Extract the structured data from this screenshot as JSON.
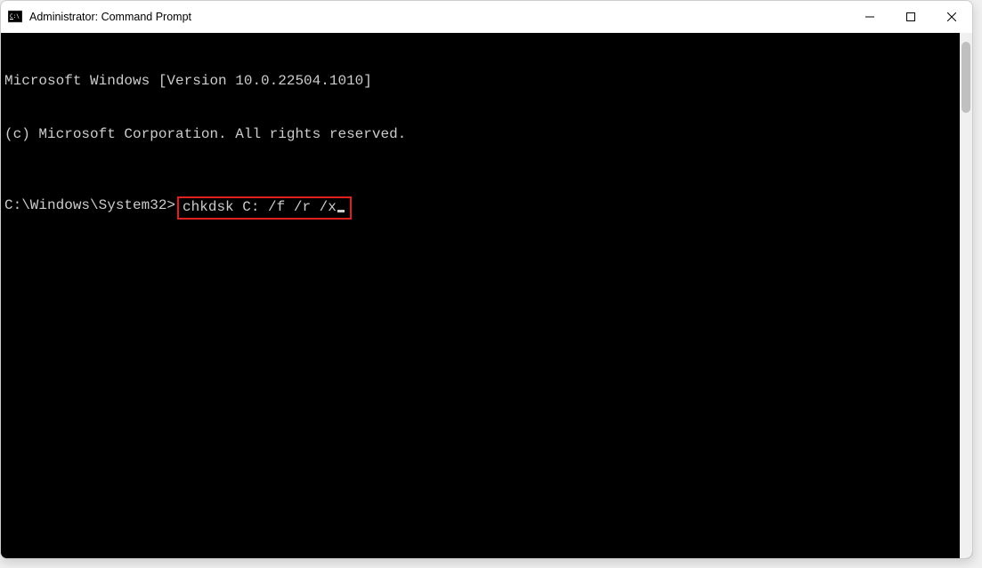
{
  "window": {
    "title": "Administrator: Command Prompt"
  },
  "terminal": {
    "lines": [
      "Microsoft Windows [Version 10.0.22504.1010]",
      "(c) Microsoft Corporation. All rights reserved."
    ],
    "prompt": "C:\\Windows\\System32>",
    "command": "chkdsk C: /f /r /x"
  }
}
